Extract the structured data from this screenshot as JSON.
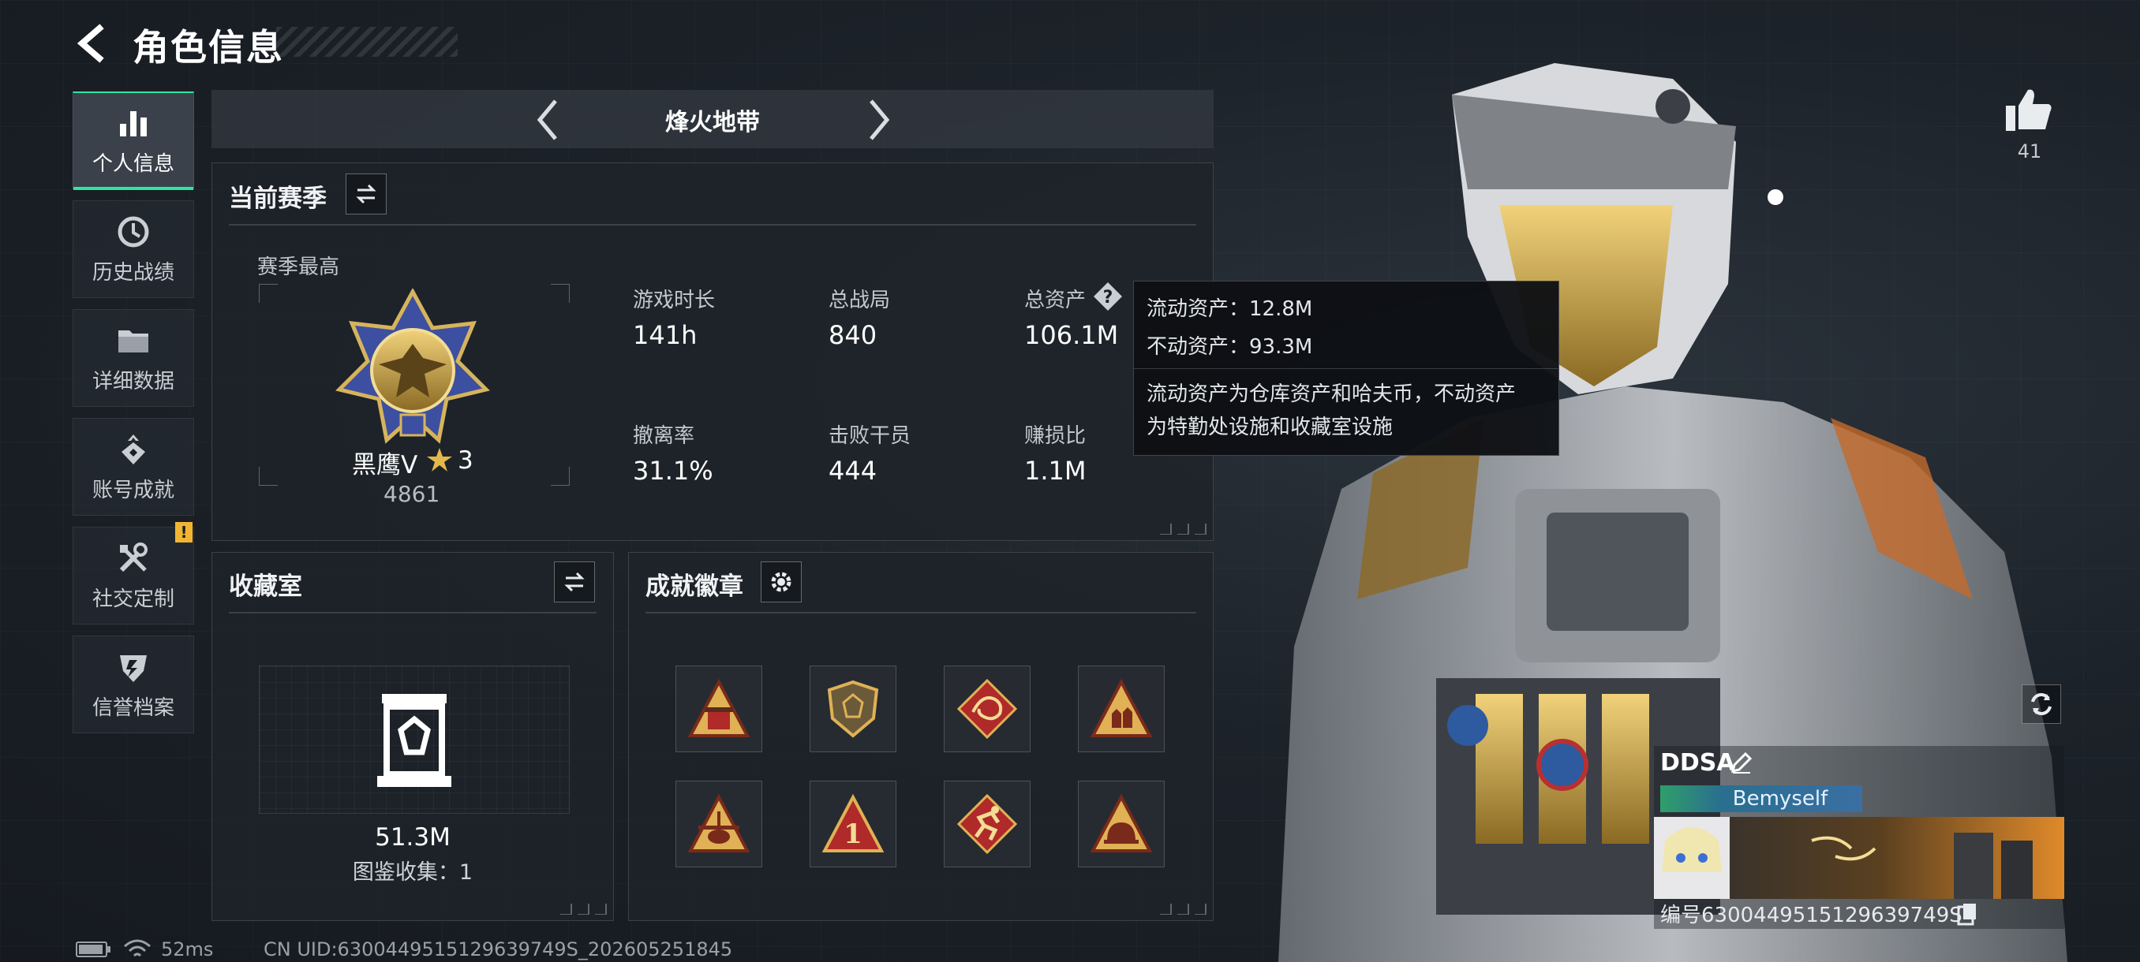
{
  "header": {
    "title": "角色信息"
  },
  "nav": {
    "items": [
      {
        "label": "个人信息",
        "icon": "bar-chart-icon",
        "active": true
      },
      {
        "label": "历史战绩",
        "icon": "history-icon",
        "active": false
      },
      {
        "label": "详细数据",
        "icon": "folder-icon",
        "active": false
      },
      {
        "label": "账号成就",
        "icon": "achievement-icon",
        "active": false
      },
      {
        "label": "社交定制",
        "icon": "tools-icon",
        "active": false,
        "badge": "!"
      },
      {
        "label": "信誉档案",
        "icon": "credit-shield-icon",
        "active": false
      }
    ]
  },
  "mode": {
    "name": "烽火地带"
  },
  "season": {
    "title": "当前赛季",
    "best_label": "赛季最高",
    "rank_name": "黑鹰Ⅴ",
    "rank_stars": "3",
    "rank_points": "4861",
    "stats": [
      {
        "label": "游戏时长",
        "value": "141h"
      },
      {
        "label": "总战局",
        "value": "840"
      },
      {
        "label": "总资产",
        "value": "106.1M"
      },
      {
        "label": "撤离率",
        "value": "31.1%"
      },
      {
        "label": "击败干员",
        "value": "444"
      },
      {
        "label": "赚损比",
        "value": "1.1M"
      }
    ]
  },
  "tooltip": {
    "line1": "流动资产：12.8M",
    "line2": "不动资产：93.3M",
    "desc1": "流动资产为仓库资产和哈夫币，不动资产",
    "desc2": "为特勤处设施和收藏室设施"
  },
  "collection": {
    "title": "收藏室",
    "value": "51.3M",
    "catalog": "图鉴收集：1"
  },
  "badges": {
    "title": "成就徽章",
    "items": [
      {
        "icon": "badge-triangle-crate-icon"
      },
      {
        "icon": "badge-shield-icon"
      },
      {
        "icon": "badge-dragon-icon"
      },
      {
        "icon": "badge-soldiers-icon"
      },
      {
        "icon": "badge-helicopter-icon"
      },
      {
        "icon": "badge-number-one-icon"
      },
      {
        "icon": "badge-runner-icon"
      },
      {
        "icon": "badge-helmet-icon"
      }
    ]
  },
  "profile": {
    "likes": "41",
    "name": "DDSA",
    "tag": "Bemyself",
    "id": "编号6300449515129639749S"
  },
  "footer": {
    "ping": "52ms",
    "uid": "CN UID:6300449515129639749S_202605251845"
  },
  "colors": {
    "accent": "#2ee6a0",
    "badge_gold": "#e0b155",
    "badge_red": "#b02a2a",
    "warning": "#f2b531"
  }
}
